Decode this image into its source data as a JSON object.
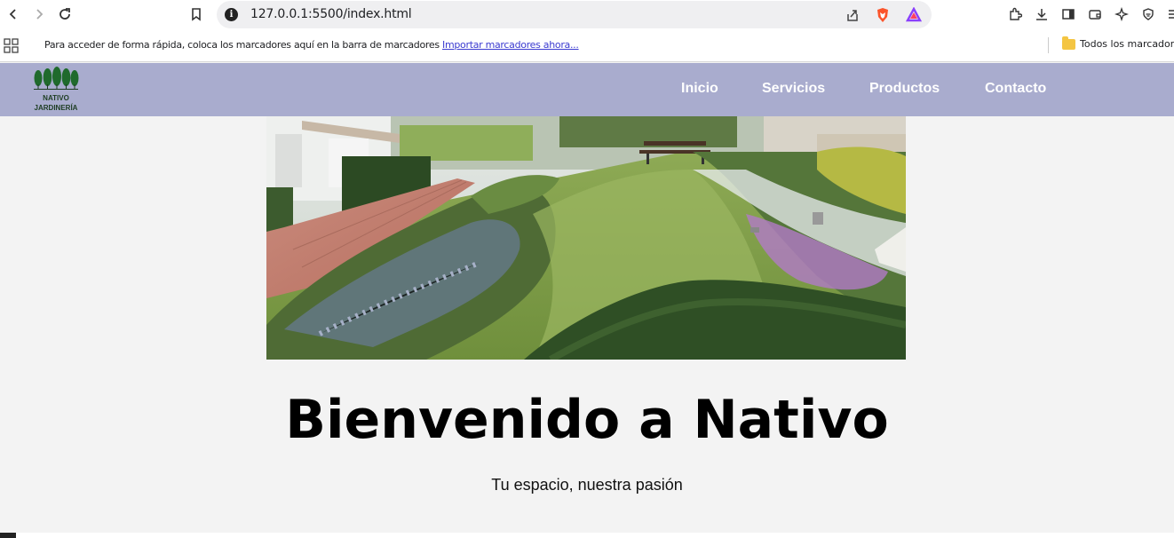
{
  "browser": {
    "url": "127.0.0.1:5500/index.html",
    "bookmarks_prompt": "Para acceder de forma rápida, coloca los marcadores aquí en la barra de marcadores",
    "bookmarks_import_link": "Importar marcadores ahora...",
    "bookmarks_folder": "Todos los marcadores"
  },
  "site": {
    "logo_line1": "NATIVO",
    "logo_line2": "JARDINERÍA",
    "menu": [
      {
        "label": "Inicio"
      },
      {
        "label": "Servicios"
      },
      {
        "label": "Productos"
      },
      {
        "label": "Contacto"
      }
    ],
    "heading": "Bienvenido a Nativo",
    "tagline": "Tu espacio, nuestra pasión"
  }
}
